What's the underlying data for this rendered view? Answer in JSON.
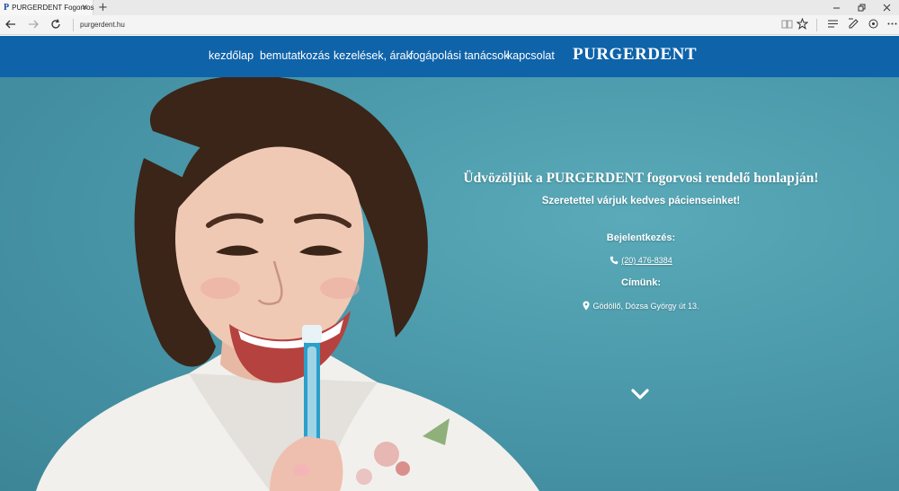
{
  "browser": {
    "tab_favicon": "P",
    "tab_title": "PURGERDENT Fogorvos",
    "tab_close": "✕",
    "new_tab": "+",
    "url": "purgerdent.hu",
    "icons": [
      "back-icon",
      "forward-icon",
      "refresh-icon",
      "reading-view-icon",
      "favorites-star-icon",
      "hub-icon",
      "web-note-icon",
      "share-icon",
      "more-icon"
    ]
  },
  "nav": {
    "items": [
      {
        "label": "kezdőlap"
      },
      {
        "label": "bemutatkozás"
      },
      {
        "label": "kezelések, árak"
      },
      {
        "label": "fogápolási tanácsok"
      },
      {
        "label": "kapcsolat"
      }
    ],
    "brand": "PURGERDENT"
  },
  "hero": {
    "title": "Üdvözöljük a PURGERDENT fogorvosi rendelő honlapján!",
    "subtitle": "Szeretettel várjuk kedves pácienseinket!",
    "booking_label": "Bejelentkezés:",
    "phone": "(20) 476-8384",
    "address_label": "Címünk:",
    "address": "Gödöllő, Dózsa György út 13."
  },
  "colors": {
    "navbar": "#0f63a9",
    "hero_bg": "#4a9fb1"
  }
}
